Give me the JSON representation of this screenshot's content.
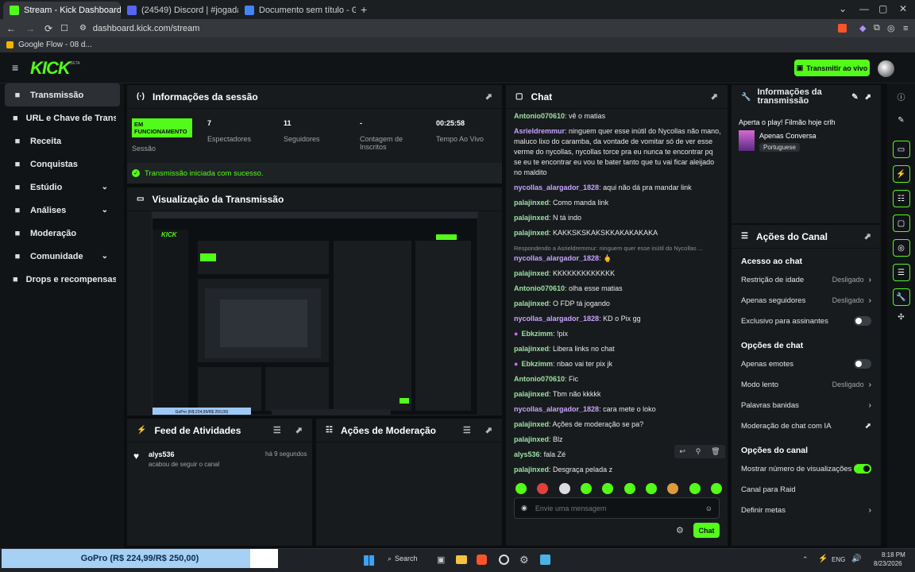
{
  "browser": {
    "tabs": [
      {
        "label": "Stream - Kick Dashboard",
        "color": "#53fc18"
      },
      {
        "label": "(24549) Discord | #jogadas | PBPI",
        "color": "#5865f2"
      },
      {
        "label": "Documento sem título - Google Docs",
        "color": "#4285f4"
      }
    ],
    "url": "dashboard.kick.com/stream",
    "bookmark": "Google Flow - 08 d..."
  },
  "header": {
    "logo": "KICK",
    "logo_badge": "BETA",
    "go_live": "Transmitir ao vivo"
  },
  "sidebar": {
    "items": [
      {
        "label": "Transmissão",
        "icon": "broadcast-icon"
      },
      {
        "label": "URL e Chave de Transmissão",
        "icon": "link-icon"
      },
      {
        "label": "Receita",
        "icon": "revenue-icon"
      },
      {
        "label": "Conquistas",
        "icon": "trophy-icon"
      },
      {
        "label": "Estúdio",
        "icon": "studio-icon"
      },
      {
        "label": "Análises",
        "icon": "analytics-icon"
      },
      {
        "label": "Moderação",
        "icon": "moderation-icon"
      },
      {
        "label": "Comunidade",
        "icon": "community-icon"
      },
      {
        "label": "Drops e recompensas",
        "icon": "drops-icon"
      }
    ]
  },
  "session": {
    "title": "Informações da sessão",
    "status_badge": "EM FUNCIONAMENTO",
    "status_label": "Sessão",
    "stats": [
      {
        "value": "7",
        "label": "Espectadores"
      },
      {
        "value": "11",
        "label": "Seguidores"
      },
      {
        "value": "-",
        "label": "Contagem de Inscritos"
      },
      {
        "value": "00:25:58",
        "label": "Tempo Ao Vivo"
      }
    ],
    "success": "Transmissão iniciada com sucesso."
  },
  "preview": {
    "title": "Visualização da Transmissão",
    "overlay_text": "GoPro (R$ 224,99/R$ 250,00)"
  },
  "activity": {
    "title": "Feed de Atividades",
    "user": "alys536",
    "time": "há 9 segundos",
    "action": "acabou de seguir o canal"
  },
  "modactions": {
    "title": "Ações de Moderação"
  },
  "chat": {
    "title": "Chat",
    "messages": [
      {
        "user": "Antonio070610",
        "text": "vê o matias",
        "cls": "u1"
      },
      {
        "user": "Asrieldremmur",
        "text": "ninguem quer esse inútil do Nycollas não mano, maluco lixo do caramba, da vontade de vomitar só de ver esse verme do nycollas, nycollas torce pra eu nunca te encontrar pq se eu te encontrar eu vou te bater tanto que tu vai ficar aleijado no maldito",
        "cls": "u2"
      },
      {
        "user": "nycollas_alargador_1828",
        "text": "aqui não dá pra mandar link",
        "cls": "u2"
      },
      {
        "user": "palajinxed",
        "text": "Como manda link",
        "cls": "u3"
      },
      {
        "user": "palajinxed",
        "text": "N tá indo",
        "cls": "u3"
      },
      {
        "user": "palajinxed",
        "text": "KAKKSKSKAKSKKAKAKAKAKA",
        "cls": "u3"
      },
      {
        "user": "nycollas_alargador_1828",
        "text": "🖕",
        "cls": "u2",
        "reply": "Respondendo a Asrieldremmur: ninguem quer esse inútil do Nycollas ..."
      },
      {
        "user": "palajinxed",
        "text": "KKKKKKKKKKKKK",
        "cls": "u3"
      },
      {
        "user": "Antonio070610",
        "text": "olha esse matias",
        "cls": "u1"
      },
      {
        "user": "palajinxed",
        "text": "O FDP tá jogando",
        "cls": "u3"
      },
      {
        "user": "nycollas_alargador_1828",
        "text": "KD o Pix gg",
        "cls": "u2"
      },
      {
        "user": "Ebkzimm",
        "text": "!pix",
        "cls": "u1",
        "badge": true
      },
      {
        "user": "palajinxed",
        "text": "Libera links no chat",
        "cls": "u3"
      },
      {
        "user": "Ebkzimm",
        "text": "nbao vai ter pix jk",
        "cls": "u1",
        "badge": true
      },
      {
        "user": "Antonio070610",
        "text": "Fic",
        "cls": "u1"
      },
      {
        "user": "palajinxed",
        "text": "Tbm não kkkkk",
        "cls": "u3"
      },
      {
        "user": "nycollas_alargador_1828",
        "text": "cara mete o loko",
        "cls": "u2"
      },
      {
        "user": "palajinxed",
        "text": "Ações de moderação se pa?",
        "cls": "u3"
      },
      {
        "user": "palajinxed",
        "text": "Blz",
        "cls": "u3"
      },
      {
        "user": "alys536",
        "text": "fala Zé",
        "cls": "u3"
      },
      {
        "user": "palajinxed",
        "text": "Desgraça pelada z",
        "cls": "u3"
      }
    ],
    "placeholder": "Envie uma mensagem",
    "send": "Chat"
  },
  "broadcast_info": {
    "title": "Informações da transmissão",
    "stream_title": "Aperta o play! Filmão hoje crlh",
    "category": "Apenas Conversa",
    "language": "Portuguese"
  },
  "channel_actions": {
    "title": "Ações do Canal",
    "sections": [
      {
        "heading": "Acesso ao chat",
        "rows": [
          {
            "label": "Restrição de idade",
            "value": "Desligado",
            "type": "arrow"
          },
          {
            "label": "Apenas seguidores",
            "value": "Desligado",
            "type": "arrow"
          },
          {
            "label": "Exclusivo para assinantes",
            "value": "",
            "type": "toggle-off"
          }
        ]
      },
      {
        "heading": "Opções de chat",
        "rows": [
          {
            "label": "Apenas emotes",
            "value": "",
            "type": "toggle-off"
          },
          {
            "label": "Modo lento",
            "value": "Desligado",
            "type": "arrow"
          },
          {
            "label": "Palavras banidas",
            "value": "",
            "type": "arrow"
          },
          {
            "label": "Moderação de chat com IA",
            "value": "",
            "type": "external"
          }
        ]
      },
      {
        "heading": "Opções do canal",
        "rows": [
          {
            "label": "Mostrar número de visualizações",
            "value": "",
            "type": "toggle-on"
          },
          {
            "label": "Canal para Raid",
            "value": "",
            "type": "none"
          },
          {
            "label": "Definir metas",
            "value": "",
            "type": "arrow"
          }
        ]
      }
    ]
  },
  "taskbar": {
    "goal": "GoPro (R$ 224,99/R$ 250,00)",
    "goal_progress": 0.9,
    "search": "Search",
    "lang": "ENG",
    "time": "8:18 PM",
    "date": "8/23/2026"
  }
}
